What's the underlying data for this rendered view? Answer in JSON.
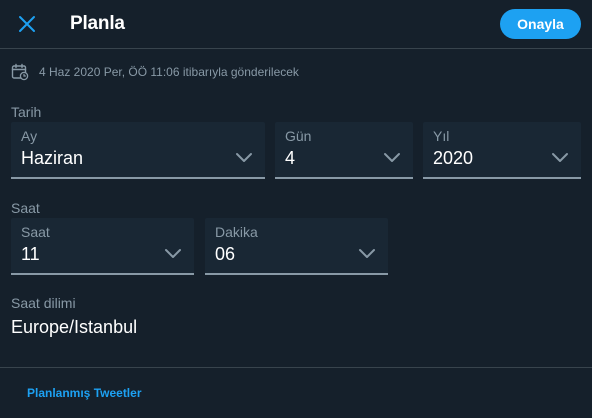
{
  "header": {
    "title": "Planla",
    "confirm_label": "Onayla"
  },
  "schedule_info": "4 Haz 2020 Per, ÖÖ 11:06 itibarıyla gönderilecek",
  "date_section": {
    "label": "Tarih",
    "month": {
      "label": "Ay",
      "value": "Haziran"
    },
    "day": {
      "label": "Gün",
      "value": "4"
    },
    "year": {
      "label": "Yıl",
      "value": "2020"
    }
  },
  "time_section": {
    "label": "Saat",
    "hour": {
      "label": "Saat",
      "value": "11"
    },
    "minute": {
      "label": "Dakika",
      "value": "06"
    }
  },
  "timezone": {
    "label": "Saat dilimi",
    "value": "Europe/Istanbul"
  },
  "footer": {
    "link_label": "Planlanmış Tweetler"
  },
  "colors": {
    "background": "#15202b",
    "field_background": "#192734",
    "accent": "#1da1f2",
    "muted_text": "#8899a6"
  },
  "icons": {
    "close": "close-icon",
    "calendar": "calendar-icon",
    "dropdown": "chevron-down-icon"
  }
}
